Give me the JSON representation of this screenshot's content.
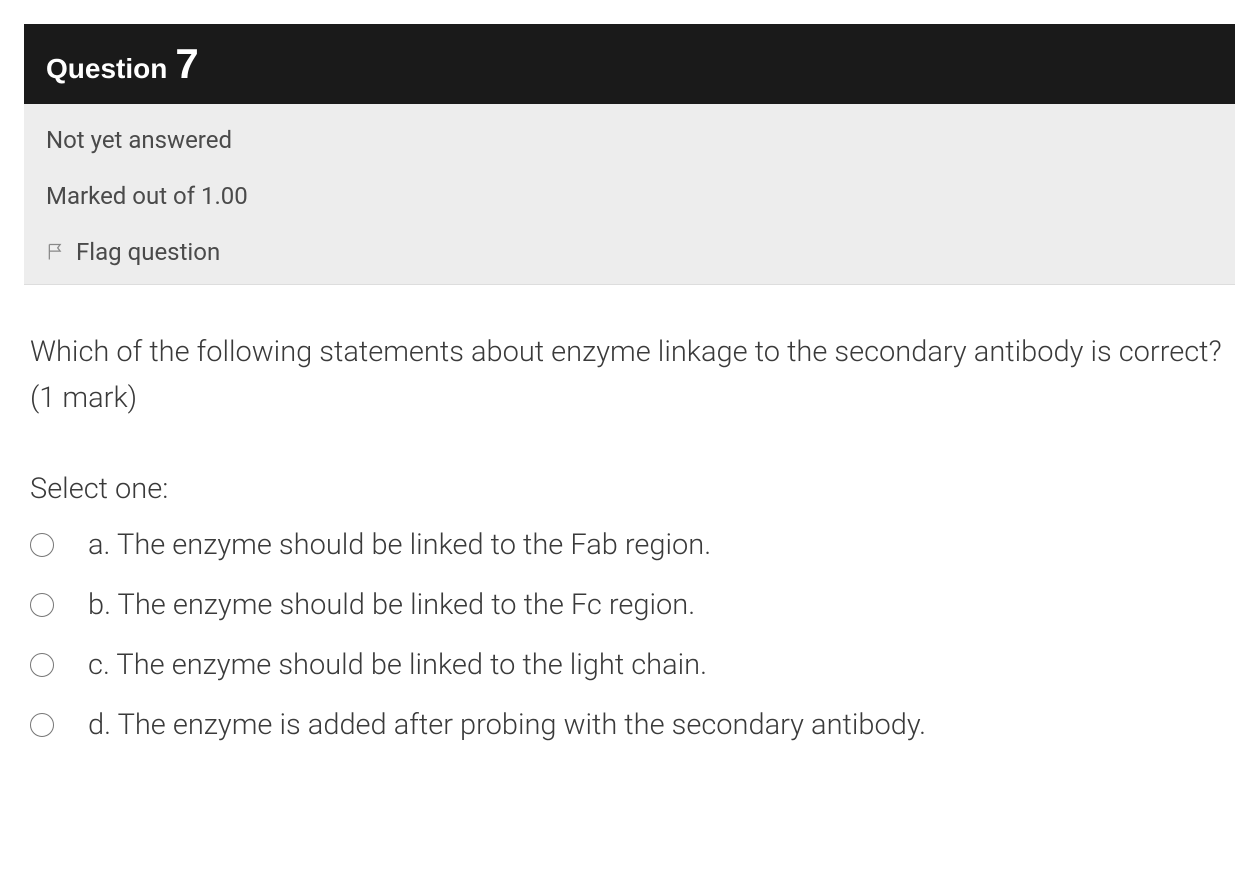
{
  "header": {
    "question_label": "Question",
    "question_number": "7"
  },
  "meta": {
    "status": "Not yet answered",
    "marks": "Marked out of 1.00",
    "flag_label": "Flag question"
  },
  "body": {
    "question_text": "Which of the following statements about enzyme linkage to the secondary antibody is correct? (1 mark)",
    "select_prompt": "Select one:",
    "options": [
      {
        "letter": "a.",
        "text": "The enzyme should be linked to the Fab region."
      },
      {
        "letter": "b.",
        "text": "The enzyme should be linked to the Fc region."
      },
      {
        "letter": "c.",
        "text": "The enzyme should be linked to the light chain."
      },
      {
        "letter": "d.",
        "text": "The enzyme is added after probing with the secondary antibody."
      }
    ]
  }
}
